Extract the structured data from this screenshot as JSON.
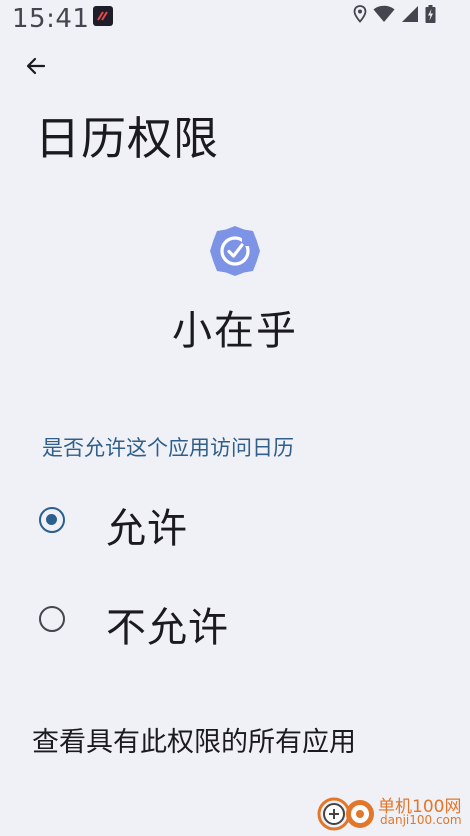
{
  "status_bar": {
    "time": "15:41",
    "icons": [
      "app-notification-icon",
      "location-icon",
      "wifi-icon",
      "signal-icon",
      "battery-charging-icon"
    ]
  },
  "header": {
    "back_icon": "arrow-left-icon",
    "title": "日历权限"
  },
  "app": {
    "icon": "check-badge-icon",
    "name": "小在乎",
    "icon_color": "#7d93e6"
  },
  "permission": {
    "question": "是否允许这个应用访问日历",
    "options": [
      {
        "label": "允许",
        "selected": true
      },
      {
        "label": "不允许",
        "selected": false
      }
    ]
  },
  "footer": {
    "see_all_label": "查看具有此权限的所有应用"
  },
  "watermark": {
    "title": "单机100网",
    "url": "danji100.com"
  },
  "colors": {
    "background": "#f0f1f6",
    "accent": "#2a5f8f",
    "question_text": "#2f5f8a",
    "watermark": "#e2762a"
  }
}
